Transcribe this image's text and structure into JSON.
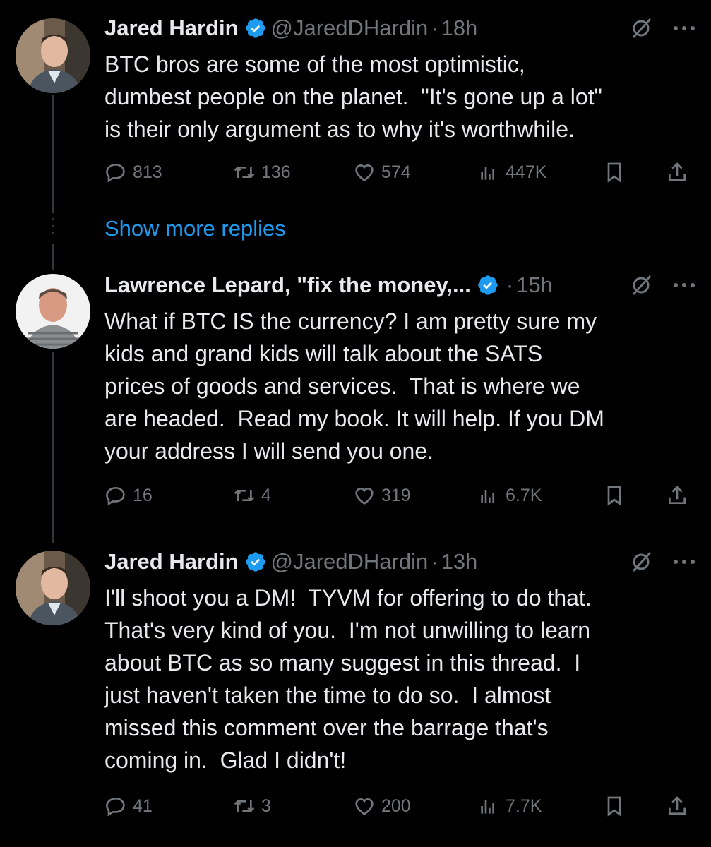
{
  "tweets": [
    {
      "name": "Jared Hardin",
      "handle": "@JaredDHardin",
      "dot": "·",
      "time": "18h",
      "text": "BTC bros are some of the most optimistic,\ndumbest people on the planet.  \"It's gone up a lot\"\nis their only argument as to why it's worthwhile.",
      "replies": "813",
      "retweets": "136",
      "likes": "574",
      "views": "447K"
    },
    {
      "name": "Lawrence Lepard, \"fix the money,...",
      "handle": "",
      "dot": "·",
      "time": "15h",
      "text": "What if BTC IS the currency? I am pretty sure my\nkids and grand kids will talk about the SATS\nprices of goods and services.  That is where we\nare headed.  Read my book. It will help. If you DM\nyour address I will send you one.",
      "replies": "16",
      "retweets": "4",
      "likes": "319",
      "views": "6.7K"
    },
    {
      "name": "Jared Hardin",
      "handle": "@JaredDHardin",
      "dot": "·",
      "time": "13h",
      "text": "I'll shoot you a DM!  TYVM for offering to do that.\nThat's very kind of you.  I'm not unwilling to learn\nabout BTC as so many suggest in this thread.  I\njust haven't taken the time to do so.  I almost\nmissed this comment over the barrage that's\ncoming in.  Glad I didn't!",
      "replies": "41",
      "retweets": "3",
      "likes": "200",
      "views": "7.7K"
    }
  ],
  "show_more_replies": "Show more replies",
  "colors": {
    "accent": "#1d9bf0",
    "muted": "#71767b",
    "text": "#e7e9ea",
    "background": "#000000"
  },
  "icons": [
    "verified-badge-icon",
    "grok-icon",
    "more-icon",
    "reply-icon",
    "retweet-icon",
    "like-icon",
    "views-icon",
    "bookmark-icon",
    "share-icon"
  ]
}
